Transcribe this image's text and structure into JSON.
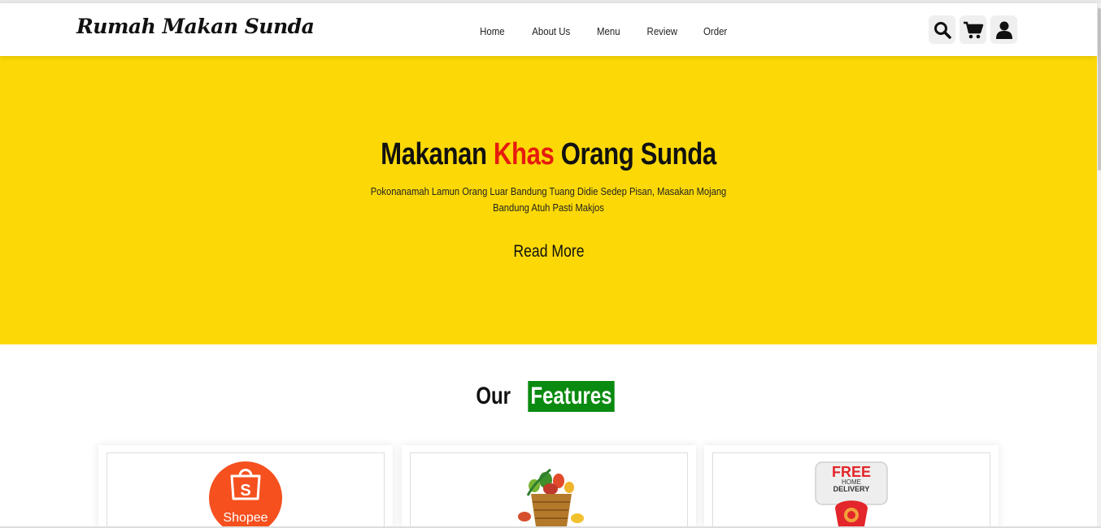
{
  "brand": {
    "name": "Rumah Makan Sunda"
  },
  "nav": {
    "items": [
      "Home",
      "About Us",
      "Menu",
      "Review",
      "Order"
    ]
  },
  "header_icons": [
    "search-icon",
    "cart-icon",
    "user-icon"
  ],
  "hero": {
    "title_before": "Makanan ",
    "title_accent": "Khas",
    "title_after": " Orang Sunda",
    "subtitle": "Pokonanamah Lamun Orang Luar Bandung Tuang Didie Sedep Pisan, Masakan Mojang Bandung Atuh Pasti Makjos",
    "button": "Read More"
  },
  "features": {
    "title_plain": "Our",
    "title_highlight": "Features",
    "cards": [
      {
        "image": "shopee-logo",
        "logo_text": "Shopee"
      },
      {
        "image": "vegetable-basket"
      },
      {
        "image": "free-home-delivery",
        "line1": "FREE",
        "line2": "HOME",
        "line3": "DELIVERY"
      }
    ]
  },
  "colors": {
    "hero_bg": "#fcd906",
    "accent_red": "#e61c0d",
    "feature_green": "#0a8a10",
    "shopee_orange": "#f5501e"
  }
}
